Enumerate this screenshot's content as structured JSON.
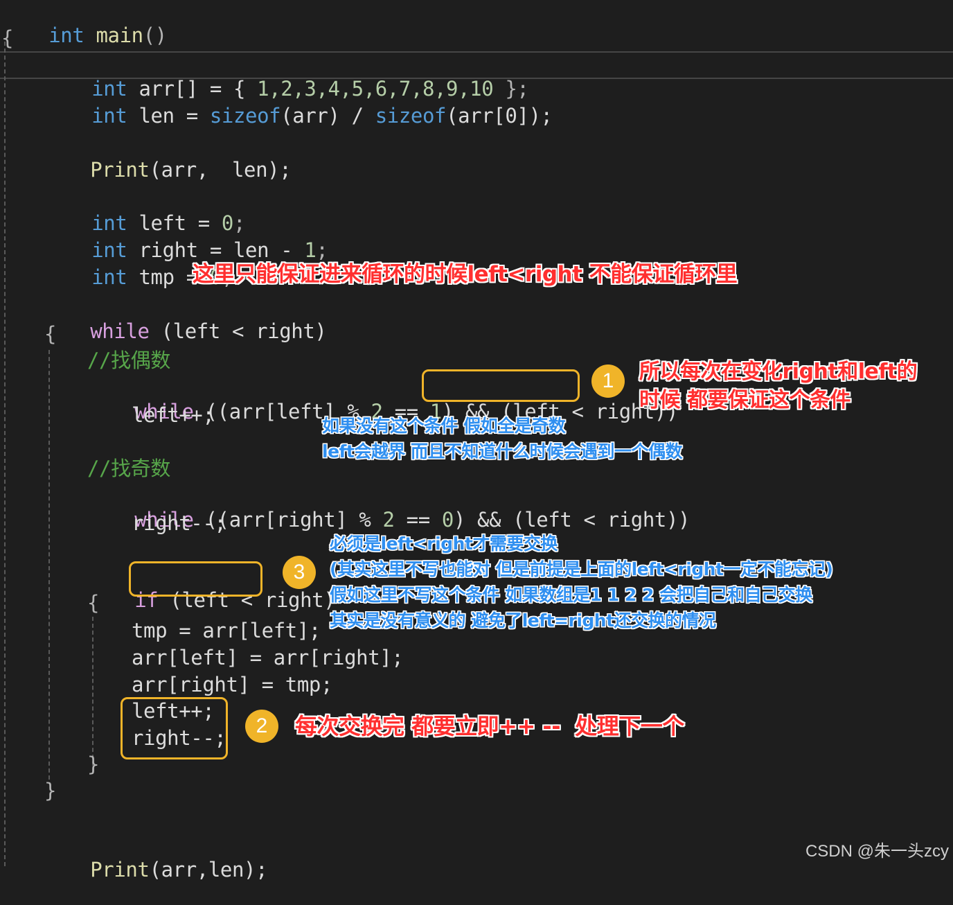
{
  "code": {
    "l1": {
      "kw": "int",
      "name": "main",
      "paren": "()"
    },
    "l2": "{",
    "l3": {
      "kw": "int",
      "decl": "arr[] = { ",
      "nums": "1,2,3,4,5,6,7,8,9,10",
      "tail": " };"
    },
    "l4": {
      "kw": "int",
      "a": "len = ",
      "s1": "sizeof",
      "b": "(arr) / ",
      "s2": "sizeof",
      "c": "(arr[0]);"
    },
    "l5": {
      "fn": "Print",
      "rest": "(arr,  len);"
    },
    "l6": {
      "kw": "int",
      "rest": "left = ",
      "num": "0",
      "semi": ";"
    },
    "l7": {
      "kw": "int",
      "rest": "right = len - ",
      "num": "1",
      "semi": ";"
    },
    "l8": {
      "kw": "int",
      "rest": "tmp = ",
      "num": "0",
      "semi": ";"
    },
    "l9": {
      "kw": "while",
      "rest": " (left < right)"
    },
    "l10": "{",
    "l11": "//找偶数",
    "l12": {
      "kw": "while",
      "a": " ((arr[left] % ",
      "n1": "2",
      "b": " == ",
      "n2": "1",
      "c": ") && (left < right))"
    },
    "l13": "left++;",
    "l14": "//找奇数",
    "l15": {
      "kw": "while",
      "a": " ((arr[right] % ",
      "n1": "2",
      "b": " == ",
      "n2": "0",
      "c": ") && (left < right))"
    },
    "l16": "right--;",
    "l17": {
      "kw": "if",
      "rest": " (left < right)"
    },
    "l18": "{",
    "l19": "tmp = arr[left];",
    "l20": "arr[left] = arr[right];",
    "l21": "arr[right] = tmp;",
    "l22": "left++;",
    "l23": "right--;",
    "l24": "}",
    "l25": "}",
    "l26": {
      "fn": "Print",
      "rest": "(arr,len);"
    }
  },
  "badges": {
    "b1": "1",
    "b2": "2",
    "b3": "3"
  },
  "notes": {
    "top": "这里只能保证进来循环的时候left<right 不能保证循环里",
    "right_1": "所以每次在变化right和left的",
    "right_2": "时候 都要保证这个条件",
    "blue_1a": "如果没有这个条件 假如全是奇数",
    "blue_1b": "left会越界 而且不知道什么时候会遇到一个偶数",
    "blue_3a": "必须是left<right才需要交换",
    "blue_3b": "(其实这里不写也能对 但是前提是上面的left<right一定不能忘记)",
    "blue_3c": "假如这里不写这个条件 如果数组是1 1 2 2 会把自己和自己交换",
    "blue_3d": "其实是没有意义的 避免了left=right还交换的情况",
    "bottom": "每次交换完 都要立即++ --  处理下一个"
  },
  "watermark": "CSDN @朱一头zcy",
  "colors": {
    "background": "#1e1e1e",
    "keyword": "#569cd6",
    "control": "#d8a0df",
    "function": "#dcdcaa",
    "comment": "#57a64a",
    "number": "#b5cea8",
    "highlight": "#f0b429",
    "note_red": "#ff2f2f",
    "note_blue": "#2f8ff0"
  }
}
